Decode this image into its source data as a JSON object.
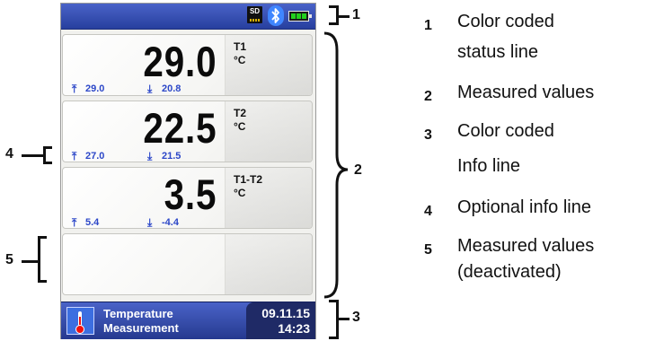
{
  "status_bar": {
    "sd_label": "SD",
    "icons": [
      "sd-card-icon",
      "bluetooth-icon",
      "battery-icon"
    ],
    "color": "#2f49b4"
  },
  "measurements": [
    {
      "value": "29.0",
      "channel": "T1",
      "unit": "°C",
      "max": "29.0",
      "min": "20.8"
    },
    {
      "value": "22.5",
      "channel": "T2",
      "unit": "°C",
      "max": "27.0",
      "min": "21.5"
    },
    {
      "value": "3.5",
      "channel": "T1-T2",
      "unit": "°C",
      "max": "5.4",
      "min": "-4.4"
    }
  ],
  "footer": {
    "title_line1": "Temperature",
    "title_line2": "Measurement",
    "date": "09.11.15",
    "time": "14:23",
    "icon": "thermometer-icon"
  },
  "callouts": {
    "status": "1",
    "values": "2",
    "info": "3",
    "optional": "4",
    "deactivated": "5"
  },
  "legend": [
    {
      "num": "1",
      "line1": "Color coded",
      "line2": "status line"
    },
    {
      "num": "2",
      "line1": "Measured values"
    },
    {
      "num": "3",
      "line1": "Color coded",
      "line2": "Info line"
    },
    {
      "num": "4",
      "line1": "Optional info line"
    },
    {
      "num": "5",
      "line1": "Measured values",
      "line2": "(deactivated)"
    }
  ]
}
